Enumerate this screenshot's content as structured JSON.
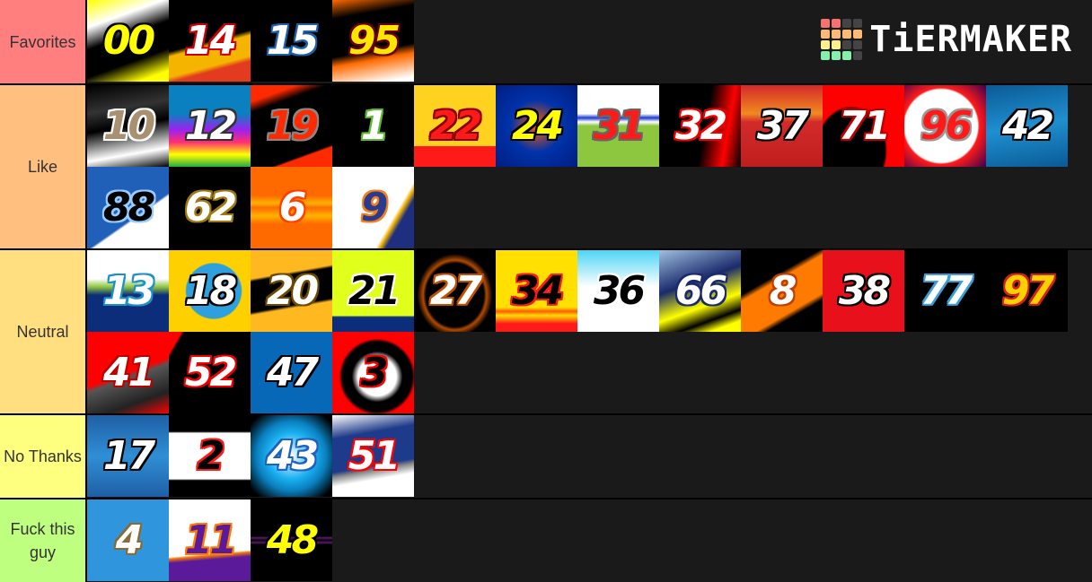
{
  "app": {
    "brand": "TiERMAKER"
  },
  "logo_grid": [
    "#f87171",
    "#f87171",
    "#444444",
    "#444444",
    "#fdba74",
    "#fdba74",
    "#fdba74",
    "#fdba74",
    "#fef08a",
    "#fef08a",
    "#444444",
    "#444444",
    "#86efac",
    "#86efac",
    "#86efac",
    "#444444"
  ],
  "tiers": [
    {
      "label": "Favorites",
      "color": "#ff7f7f",
      "items": [
        {
          "number": "00",
          "bg": "linear-gradient(160deg,#ffff00 0%,#ffffff 25%,#000 45%,#000 70%,#ffff00 90%)",
          "fg": "#ffff00",
          "stroke": "#000"
        },
        {
          "number": "14",
          "bg": "linear-gradient(165deg,#000 0%,#000 50%,#f5b400 55%,#f5b400 75%,#e33b1f 80%)",
          "fg": "#ffffff",
          "stroke": "#c00"
        },
        {
          "number": "15",
          "bg": "#000000",
          "fg": "#ffffff",
          "stroke": "#1d5fa8"
        },
        {
          "number": "95",
          "bg": "linear-gradient(170deg,#ff6a00 0%,#000 20%,#000 60%,#ff6a00 70%,#fff 95%)",
          "fg": "#ffe600",
          "stroke": "#6b0000"
        }
      ]
    },
    {
      "label": "Like",
      "color": "#ffbf7f",
      "items": [
        {
          "number": "10",
          "bg": "linear-gradient(170deg,#000 0%,#333 30%,#000 50%,#fff 80%,#000 100%)",
          "fg": "#a89070",
          "stroke": "#fff"
        },
        {
          "number": "12",
          "bg": "linear-gradient(180deg,#0a80c0 0%,#0a80c0 35%,#a020f0 55%,#ff3070 70%,#ffff00 85%,#22aa44 100%)",
          "fg": "#ffffff",
          "stroke": "#333"
        },
        {
          "number": "19",
          "bg": "linear-gradient(160deg,#ff2a00 0%,#ff2a00 15%,#000 25%,#000 80%,#ff2a00 82%)",
          "fg": "#ff2a00",
          "stroke": "#888"
        },
        {
          "number": "1",
          "bg": "#000000",
          "fg": "#ffffff",
          "stroke": "#5cb82e"
        },
        {
          "number": "22",
          "bg": "linear-gradient(180deg,#ffd21f 0%,#ffd21f 75%,#ff1a1a 75%)",
          "fg": "#ff1a1a",
          "stroke": "#8a0000"
        },
        {
          "number": "24",
          "bg": "radial-gradient(ellipse at 50% 50%,#ff5a00 0%,#0033aa 45%,#001d80 100%)",
          "fg": "#ffff00",
          "stroke": "#000"
        },
        {
          "number": "31",
          "bg": "linear-gradient(180deg,#ffffff 0%,#ffffff 35%,#1a3bd0 40%,#ffffff 45%,#8dc63f 50%)",
          "fg": "#ff1a1a",
          "stroke": "#666"
        },
        {
          "number": "32",
          "bg": "linear-gradient(100deg,#000 0%,#000 55%,#ff0000 80%,#000 100%)",
          "fg": "#ffffff",
          "stroke": "#e00"
        },
        {
          "number": "37",
          "bg": "linear-gradient(180deg,#d42a2a 0%,#f08a20 35%,#d42a2a 45%,#c01e1e 100%)",
          "fg": "#ffffff",
          "stroke": "#000"
        },
        {
          "number": "71",
          "bg": "radial-gradient(ellipse at 35% 80%,#000 0%,#000 45%,#ff0000 48%,#ff0000 100%)",
          "fg": "#ffffff",
          "stroke": "#b00"
        },
        {
          "number": "96",
          "bg": "radial-gradient(circle at 45% 50%,#ffffff 0%,#ffffff 60%,#ff1a1a 63%,#3a0050 100%)",
          "fg": "#ff1a1a",
          "stroke": "#999"
        },
        {
          "number": "42",
          "bg": "linear-gradient(170deg,#0a5a95 0%,#1f8fd0 50%,#0a5a95 100%)",
          "fg": "#ffffff",
          "stroke": "#000"
        },
        {
          "number": "88",
          "bg": "linear-gradient(145deg,#2060b8 0%,#2060b8 60%,#ffffff 62%)",
          "fg": "#000000",
          "stroke": "#9cf"
        },
        {
          "number": "62",
          "bg": "#000000",
          "fg": "#ffffff",
          "stroke": "#a07a10"
        },
        {
          "number": "6",
          "bg": "linear-gradient(180deg,#ff6a00 0%,#ff6a00 35%,#ffb300 45%,#ff6a00 50%,#ffb300 60%,#ff6a00 70%)",
          "fg": "#ffffff",
          "stroke": "#ff4000"
        },
        {
          "number": "9",
          "bg": "linear-gradient(120deg,#ffffff 0%,#ffffff 70%,#f5b400 73%,#1e2f80 78%)",
          "fg": "#2a3a8c",
          "stroke": "#f08020"
        }
      ]
    },
    {
      "label": "Neutral",
      "color": "#ffdf7f",
      "items": [
        {
          "number": "13",
          "bg": "linear-gradient(180deg,#ffffff 0%,#ffffff 35%,#8dc63f 45%,#0b2d7a 55%,#0b2d7a 100%)",
          "fg": "#ffffff",
          "stroke": "#1e90c8"
        },
        {
          "number": "18",
          "bg": "radial-gradient(circle at 55% 50%,#2da0dd 0%,#2da0dd 45%,#ffd000 47%)",
          "fg": "#ffffff",
          "stroke": "#000"
        },
        {
          "number": "20",
          "bg": "linear-gradient(170deg,#ffb81f 0%,#ffb81f 30%,#000 33%,#000 65%,#ffb81f 68%)",
          "fg": "#ffffff",
          "stroke": "#6b4a00"
        },
        {
          "number": "21",
          "bg": "linear-gradient(180deg,#e0ff1a 0%,#e0ff1a 80%,#0b2d7a 82%)",
          "fg": "#000000",
          "stroke": "#fff"
        },
        {
          "number": "27",
          "bg": "radial-gradient(ellipse at 50% 55%,#000 0%,#000 50%,#b04a00 55%,#000 65%)",
          "fg": "#ffffff",
          "stroke": "#c05000"
        },
        {
          "number": "34",
          "bg": "linear-gradient(180deg,#ffe000 0%,#ffe000 70%,#ff5a00 75%,#ffe000 80%,#ff1a1a 90%)",
          "fg": "#000000",
          "stroke": "#ff1a1a"
        },
        {
          "number": "36",
          "bg": "linear-gradient(180deg,#4dd5f5 0%,#ffffff 45%,#ffffff 100%)",
          "fg": "#000000",
          "stroke": "#fff"
        },
        {
          "number": "66",
          "bg": "linear-gradient(160deg,#9fc0e0 0%,#1a2a6b 40%,#ffff00 65%,#000 80%,#ffff00 90%)",
          "fg": "#ffffff",
          "stroke": "#1a2a6b"
        },
        {
          "number": "8",
          "bg": "linear-gradient(150deg,#000 0%,#000 35%,#ff7a00 40%,#ff7a00 70%,#000 75%)",
          "fg": "#ffffff",
          "stroke": "#c04000"
        },
        {
          "number": "38",
          "bg": "#e8101a",
          "fg": "#ffffff",
          "stroke": "#000"
        },
        {
          "number": "77",
          "bg": "#000000",
          "fg": "#ffffff",
          "stroke": "#3a9fd8"
        },
        {
          "number": "97",
          "bg": "#000000",
          "fg": "#ffd000",
          "stroke": "#d42020"
        },
        {
          "number": "41",
          "bg": "linear-gradient(160deg,#ff0000 0%,#ff0000 50%,#555 55%,#222 80%,#ff0000 100%)",
          "fg": "#ffffff",
          "stroke": "#b00"
        },
        {
          "number": "52",
          "bg": "linear-gradient(120deg,#ff0000 0%,#ff0000 10%,#000 12%)",
          "fg": "#ffffff",
          "stroke": "#e00"
        },
        {
          "number": "47",
          "bg": "#0868b8",
          "fg": "#ffffff",
          "stroke": "#000"
        },
        {
          "number": "3",
          "bg": "radial-gradient(ellipse at 55% 55%,#ffffff 0%,#ffffff 30%,#000 40%,#000 55%,#ff0000 60%)",
          "fg": "#000000",
          "stroke": "#ff0000"
        }
      ]
    },
    {
      "label": "No Thanks",
      "color": "#ffff7f",
      "items": [
        {
          "number": "17",
          "bg": "linear-gradient(180deg,#1f5fa5 0%,#2f8fd5 50%,#1f5fa5 100%)",
          "fg": "#ffffff",
          "stroke": "#000"
        },
        {
          "number": "2",
          "bg": "linear-gradient(180deg,#000 0%,#000 20%,#ffffff 22%,#ffffff 78%,#000 80%)",
          "fg": "#000000",
          "stroke": "#ff1a1a"
        },
        {
          "number": "43",
          "bg": "radial-gradient(ellipse at 50% 50%,#ffffff 0%,#1ab0f0 40%,#0a80c0 60%,#000 90%)",
          "fg": "#ffffff",
          "stroke": "#1e5fc0"
        },
        {
          "number": "51",
          "bg": "linear-gradient(170deg,#ffffff 0%,#1e3a8a 25%,#1e3a8a 60%,#888 65%,#ffffff 75%)",
          "fg": "#ffffff",
          "stroke": "#ff0000"
        }
      ]
    },
    {
      "label": "Fuck this guy",
      "color": "#bfff7f",
      "items": [
        {
          "number": "4",
          "bg": "#2f95dd",
          "fg": "#ffffff",
          "stroke": "#8a6a30"
        },
        {
          "number": "11",
          "bg": "linear-gradient(175deg,#ffffff 0%,#ffffff 65%,#ff7a00 67%,#5a1a9a 72%)",
          "fg": "#5a1a9a",
          "stroke": "#ff7a00"
        },
        {
          "number": "48",
          "bg": "linear-gradient(180deg,#000 0%,#000 45%,#5a1a6a 47%,#000 50%,#5a1a6a 53%,#000 55%)",
          "fg": "#ffff00",
          "stroke": "#000"
        }
      ]
    }
  ]
}
